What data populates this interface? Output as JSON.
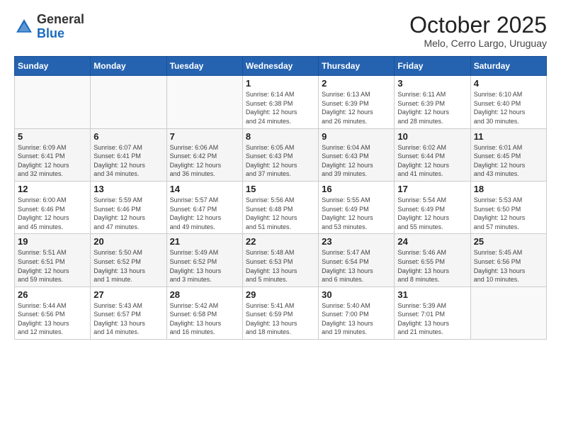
{
  "header": {
    "logo_general": "General",
    "logo_blue": "Blue",
    "month_title": "October 2025",
    "subtitle": "Melo, Cerro Largo, Uruguay"
  },
  "calendar": {
    "days_of_week": [
      "Sunday",
      "Monday",
      "Tuesday",
      "Wednesday",
      "Thursday",
      "Friday",
      "Saturday"
    ],
    "weeks": [
      [
        {
          "day": "",
          "info": ""
        },
        {
          "day": "",
          "info": ""
        },
        {
          "day": "",
          "info": ""
        },
        {
          "day": "1",
          "info": "Sunrise: 6:14 AM\nSunset: 6:38 PM\nDaylight: 12 hours\nand 24 minutes."
        },
        {
          "day": "2",
          "info": "Sunrise: 6:13 AM\nSunset: 6:39 PM\nDaylight: 12 hours\nand 26 minutes."
        },
        {
          "day": "3",
          "info": "Sunrise: 6:11 AM\nSunset: 6:39 PM\nDaylight: 12 hours\nand 28 minutes."
        },
        {
          "day": "4",
          "info": "Sunrise: 6:10 AM\nSunset: 6:40 PM\nDaylight: 12 hours\nand 30 minutes."
        }
      ],
      [
        {
          "day": "5",
          "info": "Sunrise: 6:09 AM\nSunset: 6:41 PM\nDaylight: 12 hours\nand 32 minutes."
        },
        {
          "day": "6",
          "info": "Sunrise: 6:07 AM\nSunset: 6:41 PM\nDaylight: 12 hours\nand 34 minutes."
        },
        {
          "day": "7",
          "info": "Sunrise: 6:06 AM\nSunset: 6:42 PM\nDaylight: 12 hours\nand 36 minutes."
        },
        {
          "day": "8",
          "info": "Sunrise: 6:05 AM\nSunset: 6:43 PM\nDaylight: 12 hours\nand 37 minutes."
        },
        {
          "day": "9",
          "info": "Sunrise: 6:04 AM\nSunset: 6:43 PM\nDaylight: 12 hours\nand 39 minutes."
        },
        {
          "day": "10",
          "info": "Sunrise: 6:02 AM\nSunset: 6:44 PM\nDaylight: 12 hours\nand 41 minutes."
        },
        {
          "day": "11",
          "info": "Sunrise: 6:01 AM\nSunset: 6:45 PM\nDaylight: 12 hours\nand 43 minutes."
        }
      ],
      [
        {
          "day": "12",
          "info": "Sunrise: 6:00 AM\nSunset: 6:46 PM\nDaylight: 12 hours\nand 45 minutes."
        },
        {
          "day": "13",
          "info": "Sunrise: 5:59 AM\nSunset: 6:46 PM\nDaylight: 12 hours\nand 47 minutes."
        },
        {
          "day": "14",
          "info": "Sunrise: 5:57 AM\nSunset: 6:47 PM\nDaylight: 12 hours\nand 49 minutes."
        },
        {
          "day": "15",
          "info": "Sunrise: 5:56 AM\nSunset: 6:48 PM\nDaylight: 12 hours\nand 51 minutes."
        },
        {
          "day": "16",
          "info": "Sunrise: 5:55 AM\nSunset: 6:49 PM\nDaylight: 12 hours\nand 53 minutes."
        },
        {
          "day": "17",
          "info": "Sunrise: 5:54 AM\nSunset: 6:49 PM\nDaylight: 12 hours\nand 55 minutes."
        },
        {
          "day": "18",
          "info": "Sunrise: 5:53 AM\nSunset: 6:50 PM\nDaylight: 12 hours\nand 57 minutes."
        }
      ],
      [
        {
          "day": "19",
          "info": "Sunrise: 5:51 AM\nSunset: 6:51 PM\nDaylight: 12 hours\nand 59 minutes."
        },
        {
          "day": "20",
          "info": "Sunrise: 5:50 AM\nSunset: 6:52 PM\nDaylight: 13 hours\nand 1 minute."
        },
        {
          "day": "21",
          "info": "Sunrise: 5:49 AM\nSunset: 6:52 PM\nDaylight: 13 hours\nand 3 minutes."
        },
        {
          "day": "22",
          "info": "Sunrise: 5:48 AM\nSunset: 6:53 PM\nDaylight: 13 hours\nand 5 minutes."
        },
        {
          "day": "23",
          "info": "Sunrise: 5:47 AM\nSunset: 6:54 PM\nDaylight: 13 hours\nand 6 minutes."
        },
        {
          "day": "24",
          "info": "Sunrise: 5:46 AM\nSunset: 6:55 PM\nDaylight: 13 hours\nand 8 minutes."
        },
        {
          "day": "25",
          "info": "Sunrise: 5:45 AM\nSunset: 6:56 PM\nDaylight: 13 hours\nand 10 minutes."
        }
      ],
      [
        {
          "day": "26",
          "info": "Sunrise: 5:44 AM\nSunset: 6:56 PM\nDaylight: 13 hours\nand 12 minutes."
        },
        {
          "day": "27",
          "info": "Sunrise: 5:43 AM\nSunset: 6:57 PM\nDaylight: 13 hours\nand 14 minutes."
        },
        {
          "day": "28",
          "info": "Sunrise: 5:42 AM\nSunset: 6:58 PM\nDaylight: 13 hours\nand 16 minutes."
        },
        {
          "day": "29",
          "info": "Sunrise: 5:41 AM\nSunset: 6:59 PM\nDaylight: 13 hours\nand 18 minutes."
        },
        {
          "day": "30",
          "info": "Sunrise: 5:40 AM\nSunset: 7:00 PM\nDaylight: 13 hours\nand 19 minutes."
        },
        {
          "day": "31",
          "info": "Sunrise: 5:39 AM\nSunset: 7:01 PM\nDaylight: 13 hours\nand 21 minutes."
        },
        {
          "day": "",
          "info": ""
        }
      ]
    ]
  }
}
